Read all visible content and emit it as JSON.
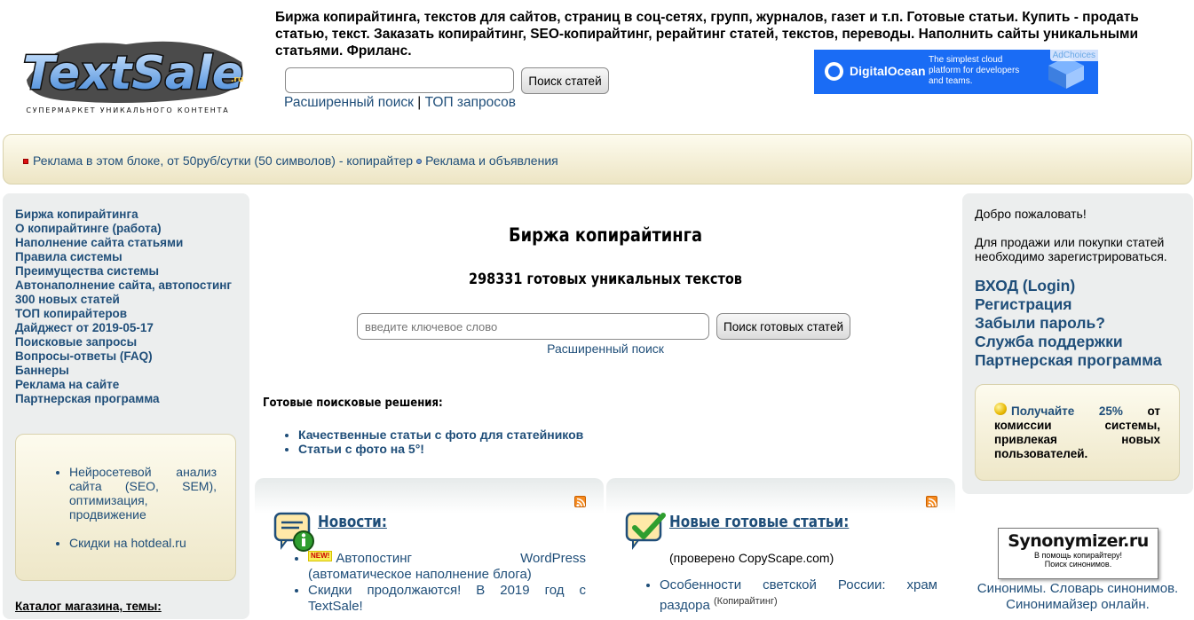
{
  "header": {
    "logo_text": "TextSale",
    "logo_domain": ".ru",
    "logo_tagline": "СУПЕРМАРКЕТ УНИКАЛЬНОГО КОНТЕНТА",
    "description": "Биржа копирайтинга, текстов для сайтов, страниц в соц-сетях, групп, журналов, газет и т.п. Готовые статьи. Купить - продать статью, текст. Заказать копирайтинг, SEO-копирайтинг, рерайтинг статей, текстов, переводы. Наполнить сайты уникальными статьями. Фриланс.",
    "search_value": "",
    "search_button": "Поиск статей",
    "advanced_link": "Расширенный поиск",
    "separator": "|",
    "top_link": "ТОП запросов"
  },
  "ad": {
    "brand": "DigitalOcean",
    "text": "The simplest cloud platform for developers and teams.",
    "choices": "AdChoices",
    "bg_color": "#1a6cf5"
  },
  "banner": {
    "item1": "Реклама в этом блоке, от 50руб/сутки (50 символов) - копирайтер",
    "item2": "Реклама и объявления"
  },
  "left_nav": [
    "Биржа копирайтинга",
    "О копирайтинге (работа)",
    "Наполнение сайта статьями",
    "Правила системы",
    "Преимущества системы",
    "Автонаполнение сайта, автопостинг",
    "300 новых статей",
    "ТОП копирайтеров",
    "Дайджест от 2019-05-17",
    "Поисковые запросы",
    "Вопросы-ответы (FAQ)",
    "Баннеры",
    "Реклама на сайте",
    "Партнерская программа"
  ],
  "left_box": {
    "item1": "Нейросетевой анализ сайта (SEO, SEM), оптимизация, продвижение",
    "item2_prefix": "Скидки на ",
    "item2_link": "hotdeal.ru"
  },
  "catalog_title": "Каталог магазина, темы:",
  "main": {
    "title": "Биржа копирайтинга",
    "count": "298331 готовых уникальных текстов",
    "search_placeholder": "введите ключевое слово",
    "search_button": "Поиск готовых статей",
    "advanced_link": "Расширенный поиск",
    "solutions_title": "Готовые поисковые решения:",
    "solutions": [
      "Качественные статьи с фото для статейников",
      "Статьи с фото на 5°!"
    ]
  },
  "news": {
    "heading": "Новости:",
    "badge": "NEW!",
    "items": [
      "Автопостинг WordPress (автоматическое наполнение блога)",
      "Скидки продолжаются! В 2019 год с TextSale!"
    ]
  },
  "articles": {
    "heading": "Новые готовые статьи:",
    "note": "(проверено CopyScape.com)",
    "item1": "Особенности светской России: храм раздора",
    "item1_tag": "(Копирайтинг)"
  },
  "right": {
    "welcome": "Добро пожаловать!",
    "register_note": "Для продажи или покупки статей необходимо зарегистрироваться.",
    "links": [
      "ВХОД (Login)",
      "Регистрация",
      "Забыли пароль?",
      "Служба поддержки",
      "Партнерская программа"
    ],
    "partner_highlight": "Получайте 25%",
    "partner_rest": " от комиссии системы, привлекая новых пользователей."
  },
  "synonymizer": {
    "title": "Synonymizer.ru",
    "sub1": "В помощь копирайтеру!",
    "sub2": "Поиск синонимов.",
    "link1": "Синонимы. Словарь синонимов.",
    "link2": "Синонимайзер онлайн."
  }
}
